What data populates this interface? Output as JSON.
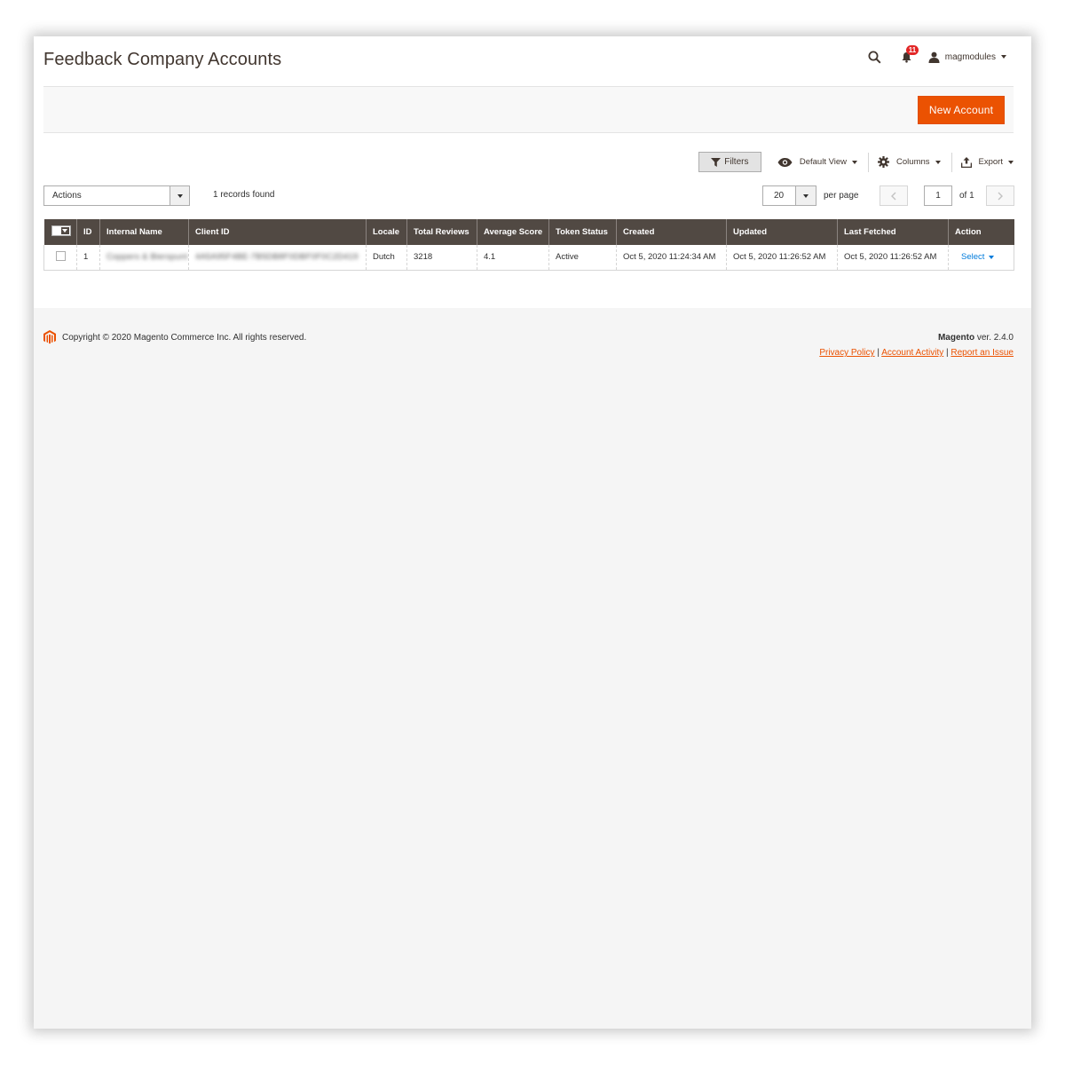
{
  "header": {
    "title": "Feedback Company Accounts",
    "notification_count": "11",
    "username": "magmodules"
  },
  "action_bar": {
    "new_account_label": "New Account"
  },
  "toolbar": {
    "filters_label": "Filters",
    "view_label": "Default View",
    "columns_label": "Columns",
    "export_label": "Export"
  },
  "grid_controls": {
    "mass_action_label": "Actions",
    "records_found": "1 records found",
    "per_page_value": "20",
    "per_page_label": "per page",
    "current_page": "1",
    "total_pages_label": "of 1"
  },
  "grid": {
    "columns": [
      "ID",
      "Internal Name",
      "Client ID",
      "Locale",
      "Total Reviews",
      "Average Score",
      "Token Status",
      "Created",
      "Updated",
      "Last Fetched",
      "Action"
    ],
    "rows": [
      {
        "id": "1",
        "internal_name": "Coppers & Bierspunt",
        "client_id": "4A5A95F4BE-7B5DB8F0DBF0F0C2D419",
        "locale": "Dutch",
        "total_reviews": "3218",
        "average_score": "4.1",
        "token_status": "Active",
        "created": "Oct 5, 2020 11:24:34 AM",
        "updated": "Oct 5, 2020 11:26:52 AM",
        "last_fetched": "Oct 5, 2020 11:26:52 AM",
        "action": "Select"
      }
    ]
  },
  "footer": {
    "copyright": "Copyright © 2020 Magento Commerce Inc. All rights reserved.",
    "brand": "Magento",
    "version": " ver. 2.4.0",
    "links": [
      "Privacy Policy",
      "Account Activity",
      "Report an Issue"
    ],
    "separator": "|"
  },
  "colors": {
    "accent": "#eb5202",
    "grid_header": "#514943",
    "link": "#007bdb",
    "badge": "#e22626"
  },
  "icons": [
    "search-icon",
    "bell-icon",
    "user-icon",
    "funnel-icon",
    "eye-icon",
    "gear-icon",
    "upload-icon",
    "magento-logo-icon"
  ]
}
